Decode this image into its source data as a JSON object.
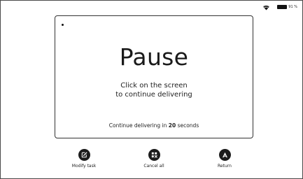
{
  "status_bar": {
    "wifi_icon": "wifi-icon",
    "battery_level": 0.91,
    "battery_text": "91 %"
  },
  "pause_card": {
    "title": "Pause",
    "message_line1": "Click on the screen",
    "message_line2": "to continue delivering",
    "countdown_prefix": "Continue delivering in ",
    "countdown_value": "20",
    "countdown_suffix": " seconds"
  },
  "actions": [
    {
      "label": "Modify task",
      "icon": "edit-icon"
    },
    {
      "label": "Cancel all",
      "icon": "grid-cancel-icon"
    },
    {
      "label": "Return",
      "icon": "return-home-icon"
    }
  ],
  "colors": {
    "ink": "#1c1c1c",
    "background": "#ffffff"
  }
}
